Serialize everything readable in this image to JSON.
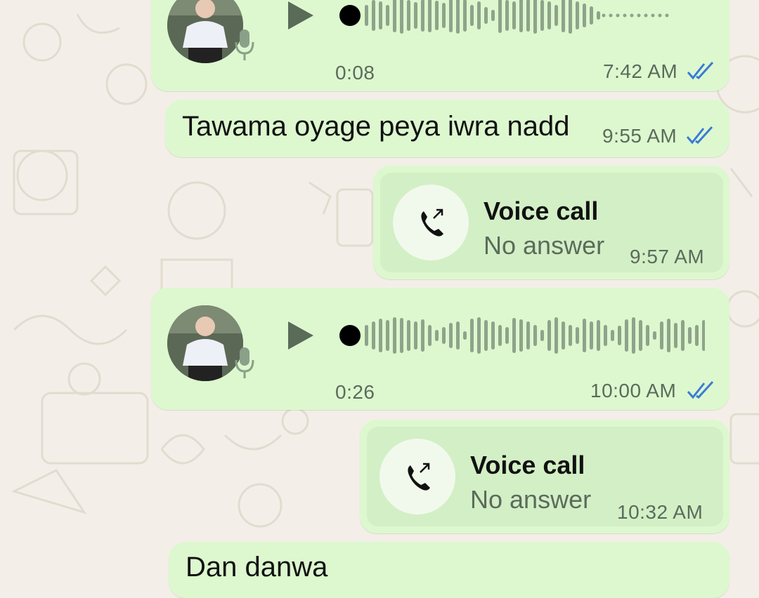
{
  "messages": {
    "voice1": {
      "duration": "0:08",
      "time": "7:42 AM"
    },
    "text1": {
      "text": "Tawama oyage peya iwra nadd",
      "time": "9:55 AM"
    },
    "call1": {
      "title": "Voice call",
      "subtitle": "No answer",
      "time": "9:57 AM"
    },
    "voice2": {
      "duration": "0:26",
      "time": "10:00 AM"
    },
    "call2": {
      "title": "Voice call",
      "subtitle": "No answer",
      "time": "10:32 AM"
    },
    "text2": {
      "text": "Dan danwa"
    }
  },
  "colors": {
    "bubble": "#ddf8cf",
    "call_panel": "#d3efc6",
    "read_ticks": "#3a7bd5",
    "wave": "#8fa38a"
  },
  "icons": [
    "play-icon",
    "mic-icon",
    "phone-outgoing-icon",
    "double-check-icon"
  ]
}
